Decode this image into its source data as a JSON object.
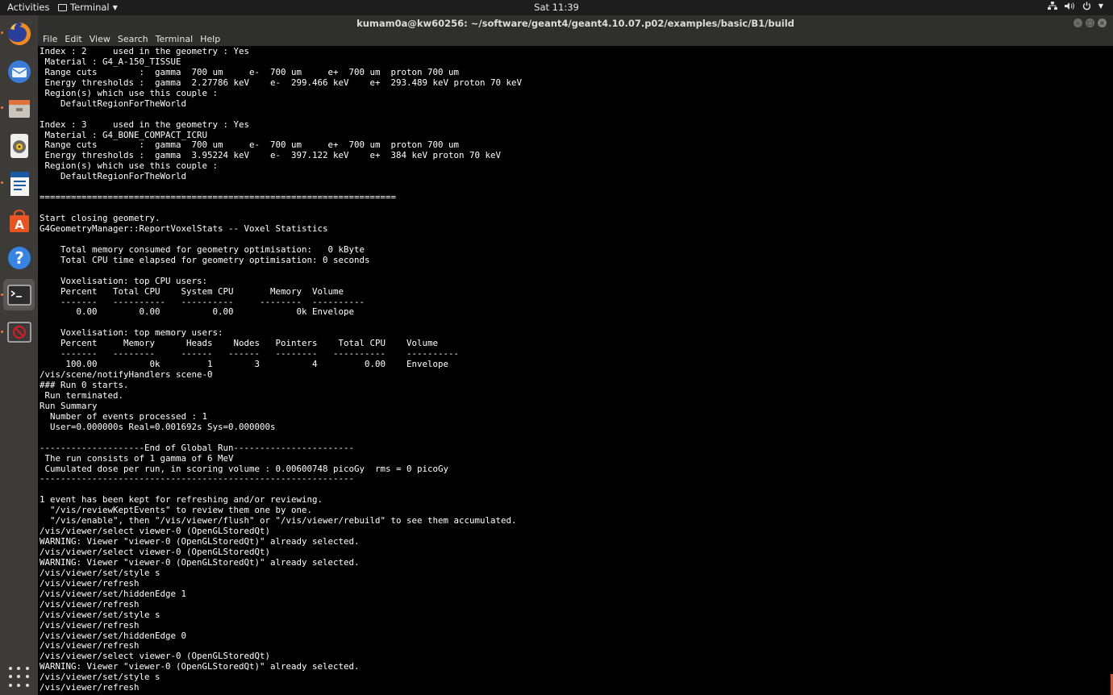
{
  "topbar": {
    "activities": "Activities",
    "app_name": "Terminal",
    "clock": "Sat 11:39",
    "status_icons": [
      "network-icon",
      "volume-icon",
      "power-icon"
    ]
  },
  "dock": {
    "items": [
      {
        "name": "firefox-launcher",
        "icon": "firefox-icon",
        "running": true
      },
      {
        "name": "thunderbird-launcher",
        "icon": "mail-icon",
        "running": false
      },
      {
        "name": "files-launcher",
        "icon": "files-icon",
        "running": true
      },
      {
        "name": "rhythmbox-launcher",
        "icon": "music-icon",
        "running": false
      },
      {
        "name": "writer-launcher",
        "icon": "document-icon",
        "running": true
      },
      {
        "name": "software-launcher",
        "icon": "software-icon",
        "running": false
      },
      {
        "name": "help-launcher",
        "icon": "help-icon",
        "running": false
      },
      {
        "name": "terminal-launcher",
        "icon": "terminal-icon",
        "running": true,
        "active": true
      },
      {
        "name": "blocked-launcher",
        "icon": "no-entry-icon",
        "running": true
      }
    ],
    "show_apps": "show-applications-icon"
  },
  "window": {
    "title": "kumam0a@kw60256: ~/software/geant4/geant4.10.07.p02/examples/basic/B1/build",
    "menu": [
      "File",
      "Edit",
      "View",
      "Search",
      "Terminal",
      "Help"
    ]
  },
  "terminal": {
    "lines": [
      "Index : 2     used in the geometry : Yes",
      " Material : G4_A-150_TISSUE",
      " Range cuts        :  gamma  700 um     e-  700 um     e+  700 um  proton 700 um",
      " Energy thresholds :  gamma  2.27786 keV    e-  299.466 keV    e+  293.489 keV proton 70 keV",
      " Region(s) which use this couple :",
      "    DefaultRegionForTheWorld",
      "",
      "Index : 3     used in the geometry : Yes",
      " Material : G4_BONE_COMPACT_ICRU",
      " Range cuts        :  gamma  700 um     e-  700 um     e+  700 um  proton 700 um",
      " Energy thresholds :  gamma  3.95224 keV    e-  397.122 keV    e+  384 keV proton 70 keV",
      " Region(s) which use this couple :",
      "    DefaultRegionForTheWorld",
      "",
      "====================================================================",
      "",
      "Start closing geometry.",
      "G4GeometryManager::ReportVoxelStats -- Voxel Statistics",
      "",
      "    Total memory consumed for geometry optimisation:   0 kByte",
      "    Total CPU time elapsed for geometry optimisation: 0 seconds",
      "",
      "    Voxelisation: top CPU users:",
      "    Percent   Total CPU    System CPU       Memory  Volume",
      "    -------   ----------   ----------     --------  ----------",
      "       0.00        0.00          0.00            0k Envelope",
      "",
      "    Voxelisation: top memory users:",
      "    Percent     Memory      Heads    Nodes   Pointers    Total CPU    Volume",
      "    -------   --------     ------   ------   --------   ----------    ----------",
      "     100.00          0k         1        3          4         0.00    Envelope",
      "/vis/scene/notifyHandlers scene-0",
      "### Run 0 starts.",
      " Run terminated.",
      "Run Summary",
      "  Number of events processed : 1",
      "  User=0.000000s Real=0.001692s Sys=0.000000s",
      "",
      "--------------------End of Global Run-----------------------",
      " The run consists of 1 gamma of 6 MeV",
      " Cumulated dose per run, in scoring volume : 0.00600748 picoGy  rms = 0 picoGy",
      "------------------------------------------------------------",
      "",
      "1 event has been kept for refreshing and/or reviewing.",
      "  \"/vis/reviewKeptEvents\" to review them one by one.",
      "  \"/vis/enable\", then \"/vis/viewer/flush\" or \"/vis/viewer/rebuild\" to see them accumulated.",
      "/vis/viewer/select viewer-0 (OpenGLStoredQt)",
      "WARNING: Viewer \"viewer-0 (OpenGLStoredQt)\" already selected.",
      "/vis/viewer/select viewer-0 (OpenGLStoredQt)",
      "WARNING: Viewer \"viewer-0 (OpenGLStoredQt)\" already selected.",
      "/vis/viewer/set/style s",
      "/vis/viewer/refresh",
      "/vis/viewer/set/hiddenEdge 1",
      "/vis/viewer/refresh",
      "/vis/viewer/set/style s",
      "/vis/viewer/refresh",
      "/vis/viewer/set/hiddenEdge 0",
      "/vis/viewer/refresh",
      "/vis/viewer/select viewer-0 (OpenGLStoredQt)",
      "WARNING: Viewer \"viewer-0 (OpenGLStoredQt)\" already selected.",
      "/vis/viewer/set/style s",
      "/vis/viewer/refresh"
    ]
  }
}
